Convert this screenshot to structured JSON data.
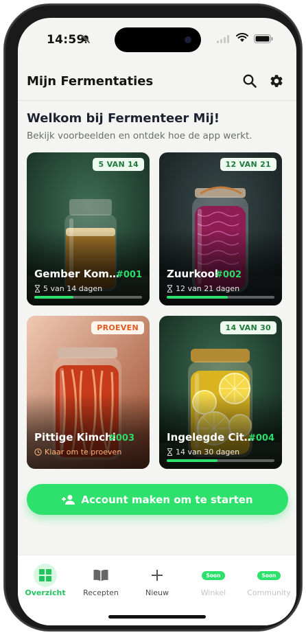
{
  "status": {
    "time": "14:59"
  },
  "header": {
    "title": "Mijn Fermentaties"
  },
  "welcome": {
    "title": "Welkom bij Fermenteer Mij!",
    "subtitle": "Bekijk voorbeelden en ontdek hoe de app werkt."
  },
  "cards": [
    {
      "badge": "5 VAN 14",
      "name": "Gember Kom…",
      "number": "#001",
      "meta": "5 van 14 dagen",
      "progress": 0.36
    },
    {
      "badge": "12 VAN 21",
      "name": "Zuurkool",
      "number": "#002",
      "meta": "12 van 21 dagen",
      "progress": 0.57
    },
    {
      "badge": "PROEVEN",
      "name": "Pittige Kimchi",
      "number": "#003",
      "meta": "Klaar om te proeven",
      "progress": 1.0
    },
    {
      "badge": "14 VAN 30",
      "name": "Ingelegde Cit…",
      "number": "#004",
      "meta": "14 van 30 dagen",
      "progress": 0.47
    }
  ],
  "cta": {
    "label": "Account maken om te starten"
  },
  "tabs": [
    {
      "label": "Overzicht",
      "icon": "grid-icon"
    },
    {
      "label": "Recepten",
      "icon": "book-icon"
    },
    {
      "label": "Nieuw",
      "icon": "plus-icon"
    },
    {
      "label": "Winkel",
      "soon": "Soon"
    },
    {
      "label": "Community",
      "soon": "Soon"
    }
  ],
  "colors": {
    "accent": "#2ee06c",
    "badge_text": "#1e7a3a",
    "tasting": "#e05a1c"
  }
}
